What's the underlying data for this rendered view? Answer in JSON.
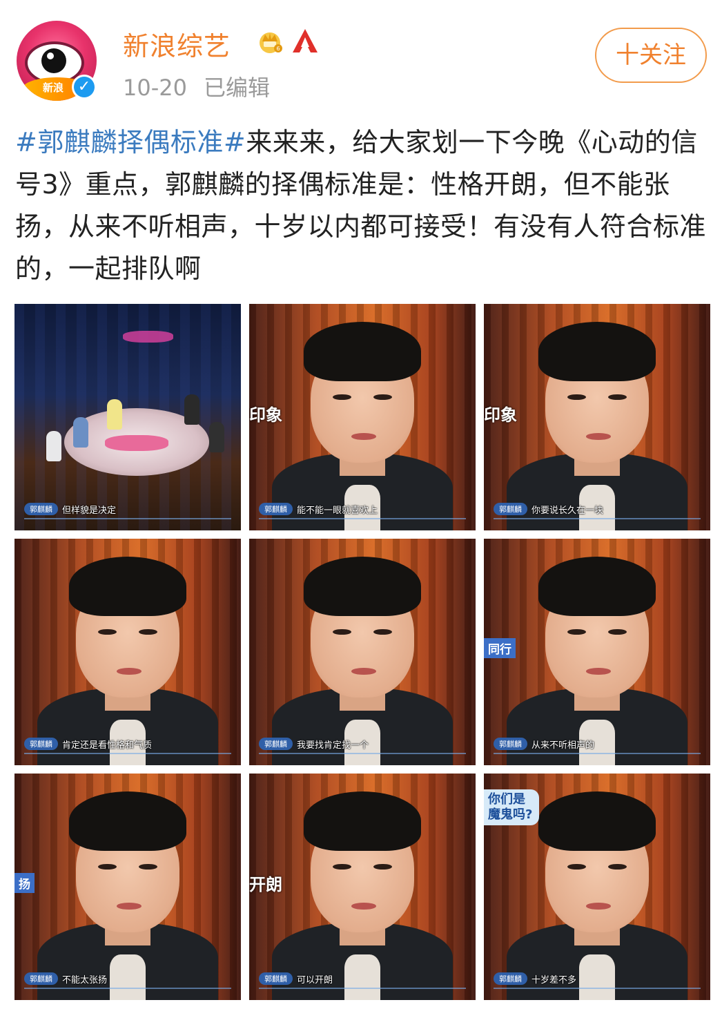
{
  "account": {
    "name": "新浪综艺",
    "avatar_text": "新浪",
    "date": "10-20",
    "edited": "已编辑",
    "follow_label": "十关注",
    "icons": [
      "crown-icon",
      "vip-red-a-icon",
      "verified-icon"
    ]
  },
  "post": {
    "hashtag": "#郭麒麟择偶标准#",
    "text": "来来来，给大家划一下今晚《心动的信号3》重点，郭麒麟的择偶标准是：性格开朗，但不能张扬，从来不听相声，十岁以内都可接受！有没有人符合标准的，一起排队啊"
  },
  "images": [
    {
      "tag": "郭麒麟",
      "caption": "但样貌是决定"
    },
    {
      "tag": "郭麒麟",
      "caption": "能不能一眼就喜欢上",
      "side": "印象"
    },
    {
      "tag": "郭麒麟",
      "caption": "你要说长久在一块",
      "side": "印象"
    },
    {
      "tag": "郭麒麟",
      "caption": "肯定还是看性格和气质"
    },
    {
      "tag": "郭麒麟",
      "caption": "我要找肯定找一个"
    },
    {
      "tag": "郭麒麟",
      "caption": "从来不听相声的",
      "side": "同行"
    },
    {
      "tag": "郭麒麟",
      "caption": "不能太张扬",
      "side": "扬"
    },
    {
      "tag": "郭麒麟",
      "caption": "可以开朗",
      "side": "开朗"
    },
    {
      "tag": "郭麒麟",
      "caption": "十岁差不多",
      "bubble": "你们是魔鬼吗?"
    }
  ],
  "colors": {
    "username": "#f0812e",
    "hashtag": "#3b7bbf",
    "meta": "#9a9a9a",
    "follow_border": "#f29b4b"
  }
}
